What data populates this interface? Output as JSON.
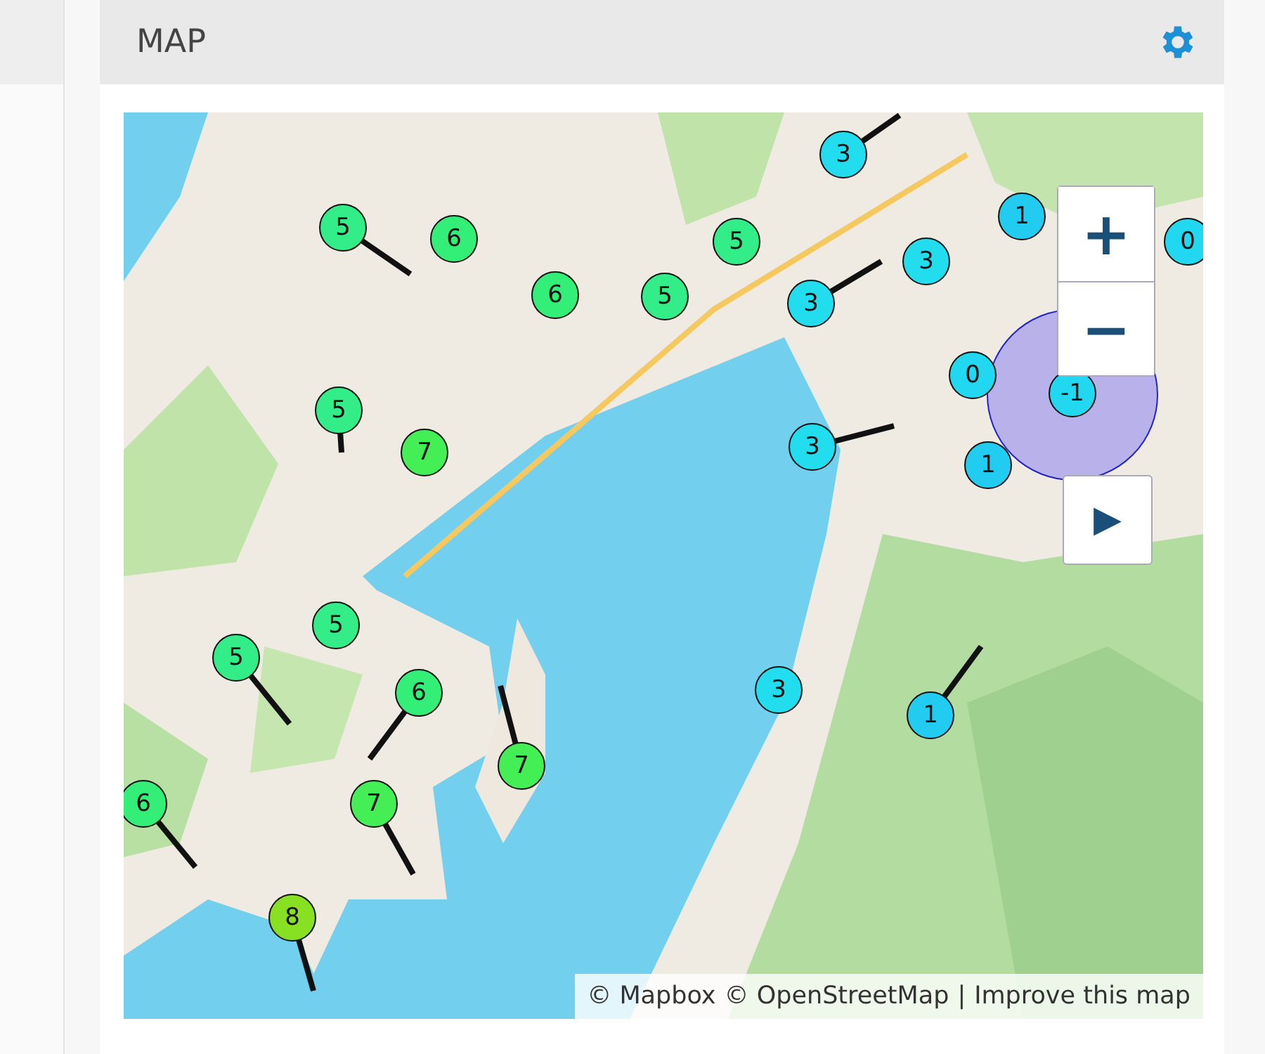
{
  "panel": {
    "title": "MAP"
  },
  "map": {
    "kind": "picture",
    "markers": [
      {
        "label": "3",
        "color": "#22ddee"
      },
      {
        "label": "6",
        "color": "#33ee77"
      },
      {
        "label": "5",
        "color": "#33ee88"
      },
      {
        "label": "6",
        "color": "#33ee77"
      },
      {
        "label": "5",
        "color": "#33ee88"
      },
      {
        "label": "5",
        "color": "#33ee88"
      },
      {
        "label": "3",
        "color": "#22ddee"
      },
      {
        "label": "3",
        "color": "#22ddee"
      },
      {
        "label": "1",
        "color": "#22ccf0"
      },
      {
        "label": "0",
        "color": "#22d8f0"
      },
      {
        "label": "0",
        "color": "#22d8f0"
      },
      {
        "label": "-1",
        "color": "#22d8f0"
      },
      {
        "label": "1",
        "color": "#22ccf0"
      },
      {
        "label": "3",
        "color": "#22ddee"
      },
      {
        "label": "5",
        "color": "#33ee88"
      },
      {
        "label": "7",
        "color": "#44ee55"
      },
      {
        "label": "5",
        "color": "#33ee88"
      },
      {
        "label": "5",
        "color": "#33ee88"
      },
      {
        "label": "6",
        "color": "#33ee77"
      },
      {
        "label": "7",
        "color": "#44ee55"
      },
      {
        "label": "3",
        "color": "#22ddee"
      },
      {
        "label": "1",
        "color": "#22ccf0"
      },
      {
        "label": "6",
        "color": "#33ee77"
      },
      {
        "label": "7",
        "color": "#44ee55"
      },
      {
        "label": "8",
        "color": "#88e022"
      }
    ],
    "zoom_in": "+",
    "zoom_out": "−",
    "play": "▶",
    "attribution": {
      "mapbox": "© Mapbox",
      "osm": "© OpenStreetMap",
      "separator": "|",
      "improve": "Improve this map"
    }
  }
}
